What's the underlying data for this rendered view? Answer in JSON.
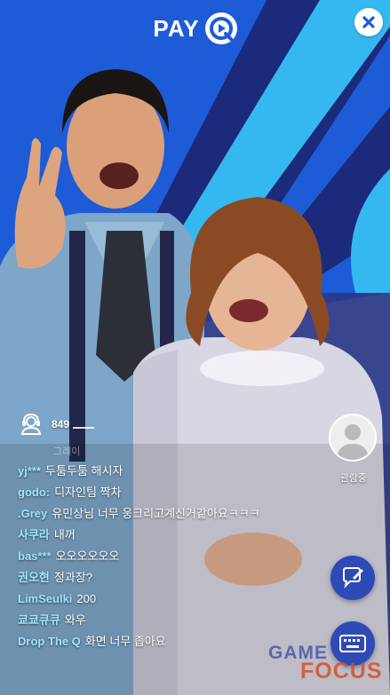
{
  "brand": {
    "text": "PAY",
    "logo_icon": "q-play-logo-icon"
  },
  "close_icon": "close-icon",
  "viewers": {
    "icon": "headset-person-icon",
    "count": "849",
    "faded_label": "그레이"
  },
  "chat": [
    {
      "user": "yj***",
      "message": "두툼두툼 해시자"
    },
    {
      "user": "godo:",
      "message": "디자인팀 짝차"
    },
    {
      "user": ".Grey",
      "message": "유민상님 너무 웅크리고계신거같아요ㅋㅋㅋ"
    },
    {
      "user": "사쿠라",
      "message": "내꺼"
    },
    {
      "user": "bas***",
      "message": "오오오오오오"
    },
    {
      "user": "권오현",
      "message": "정과장?"
    },
    {
      "user": "LimSeulki",
      "message": "200"
    },
    {
      "user": "쿄쿄큐큐",
      "message": "와우"
    },
    {
      "user": "Drop The Q",
      "message": "화면 너무 좁아요"
    }
  ],
  "watching": {
    "avatar_icon": "user-avatar-icon",
    "label": "관람중"
  },
  "buttons": {
    "chat_icon": "chat-edit-icon",
    "keyboard_icon": "keyboard-icon"
  },
  "watermark": {
    "line1": "GAME",
    "line2": "FOCUS"
  },
  "colors": {
    "background_blue": "#1e5bd6",
    "stripe_cyan": "#35b8f0",
    "navy": "#1b2a7a",
    "chat_username": "#9ee6ff",
    "button_blue": "#2d4ab6"
  }
}
